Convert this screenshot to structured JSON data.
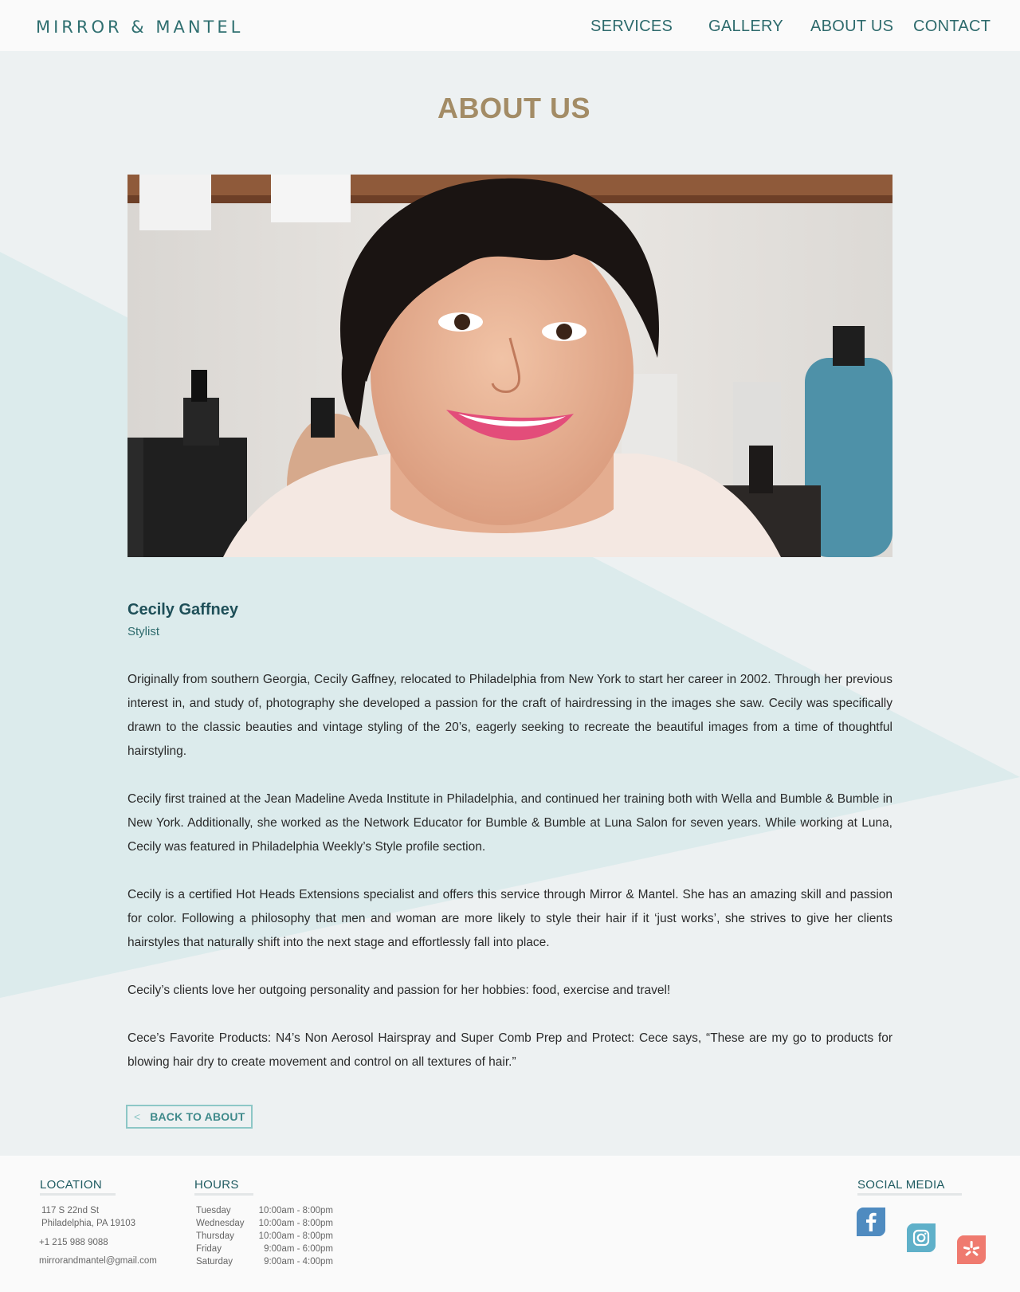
{
  "brand": {
    "logo": "MIRROR & MANTEL"
  },
  "nav": {
    "services": "SERVICES",
    "gallery": "GALLERY",
    "about": "ABOUT US",
    "contact": "CONTACT"
  },
  "page": {
    "title": "ABOUT US"
  },
  "profile": {
    "name": "Cecily Gaffney",
    "role": "Stylist",
    "paragraphs": [
      "Originally from southern Georgia, Cecily Gaffney, relocated to Philadelphia from New York to start her career in 2002. Through her previous interest in, and study of, photography she developed a passion for the craft of hairdressing in the images she saw. Cecily was specifically drawn to the classic beauties and vintage styling of the 20’s, eagerly seeking to recreate the beautiful images from a time of thoughtful hairstyling.",
      "Cecily first trained at the Jean Madeline Aveda Institute in Philadelphia, and continued her training both with Wella and Bumble & Bumble in New York. Additionally, she worked as the Network Educator for Bumble & Bumble at Luna Salon for seven years. While working at Luna, Cecily was featured in Philadelphia Weekly’s Style profile section.",
      "Cecily is a certified Hot Heads Extensions specialist and offers this service through Mirror & Mantel. She has an amazing skill and passion for color. Following a philosophy that men and woman are more likely to style their hair if it ‘just works’, she strives to give her clients hairstyles that naturally shift into the next stage and effortlessly fall into place.",
      "Cecily’s clients love her outgoing personality and passion for her hobbies: food, exercise and travel!",
      "Cece’s Favorite Products: N4’s Non Aerosol Hairspray and Super Comb Prep and Protect: Cece says, “These are my go to products for blowing hair dry to create movement and control on all textures of hair.”"
    ]
  },
  "back_button": {
    "icon": "chevron-left-icon",
    "label": "BACK TO ABOUT"
  },
  "footer": {
    "location": {
      "heading": "LOCATION",
      "address_line1": "117 S 22nd St",
      "address_line2": "Philadelphia, PA 19103",
      "phone": "+1 215 988 9088",
      "email": "mirrorandmantel@gmail.com"
    },
    "hours": {
      "heading": "HOURS",
      "rows": [
        {
          "day": "Tuesday",
          "time": "10:00am - 8:00pm"
        },
        {
          "day": "Wednesday",
          "time": "10:00am - 8:00pm"
        },
        {
          "day": "Thursday",
          "time": "10:00am - 8:00pm"
        },
        {
          "day": "Friday",
          "time": "9:00am - 6:00pm"
        },
        {
          "day": "Saturday",
          "time": "9:00am - 4:00pm"
        }
      ]
    },
    "social": {
      "heading": "SOCIAL MEDIA",
      "icons": [
        "facebook-icon",
        "instagram-icon",
        "yelp-icon"
      ]
    }
  },
  "colors": {
    "brand_teal": "#2d6a6c",
    "title_gold": "#a38c66",
    "accent_light_teal": "#8dc7c6",
    "background": "#edf1f2",
    "triangle": "#dcebec"
  }
}
